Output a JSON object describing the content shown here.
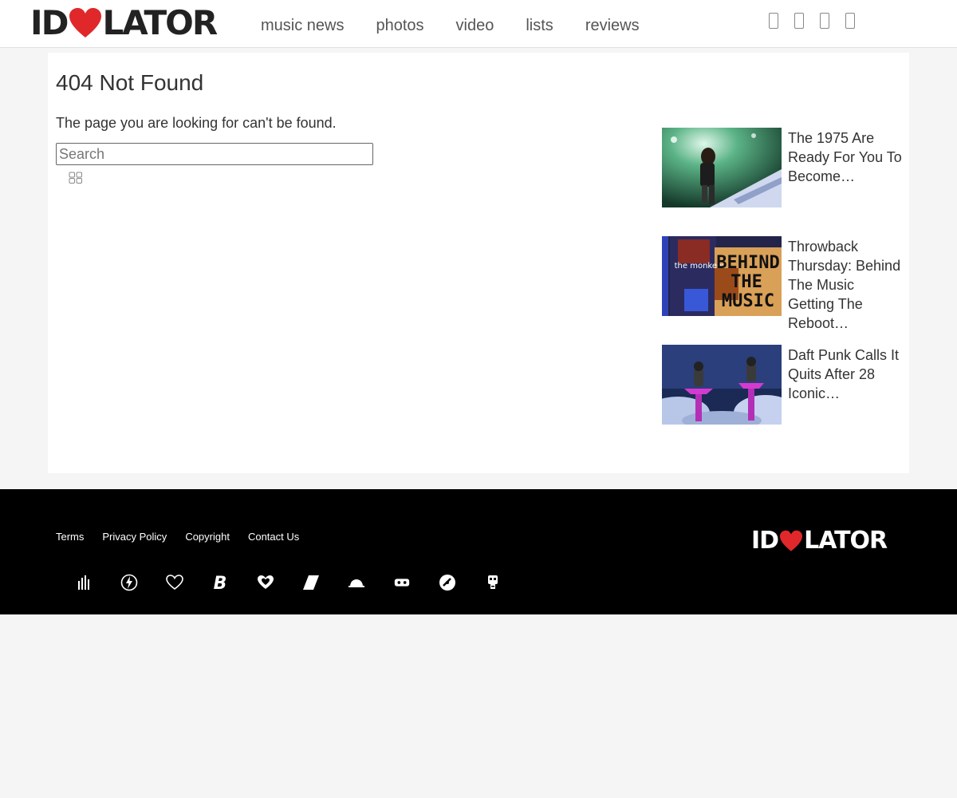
{
  "header": {
    "logo": {
      "left": "ID",
      "right": "LATOR"
    },
    "nav": [
      "music news",
      "photos",
      "video",
      "lists",
      "reviews"
    ],
    "social_icons": [
      "facebook-icon",
      "twitter-icon",
      "instagram-icon",
      "youtube-icon"
    ]
  },
  "main": {
    "title": "404 Not Found",
    "message": "The page you are looking for can't be found.",
    "search": {
      "placeholder": "Search",
      "button_icon": "search-icon"
    }
  },
  "related": [
    {
      "title": "The 1975 Are Ready For You To Become…"
    },
    {
      "title": "Throwback Thursday: Behind The Music Getting The Reboot…",
      "thumb_text": {
        "small": "the monkees",
        "big1": "BEHIND",
        "big2": "THE",
        "big3": "MUSIC"
      }
    },
    {
      "title": "Daft Punk Calls It Quits After 28 Iconic…"
    }
  ],
  "footer": {
    "links": [
      "Terms",
      "Privacy Policy",
      "Copyright",
      "Contact Us"
    ],
    "logo": {
      "left": "ID",
      "right": "LATOR"
    },
    "network_icons": [
      "bars-icon",
      "bolt-icon",
      "heart-outline-icon",
      "b-letter-icon",
      "double-heart-icon",
      "slash-icon",
      "hat-icon",
      "bot-icon",
      "record-icon",
      "robot-icon"
    ]
  },
  "colors": {
    "heart": "#e0282b",
    "footer_bg": "#000000",
    "page_bg": "#f5f5f5"
  }
}
